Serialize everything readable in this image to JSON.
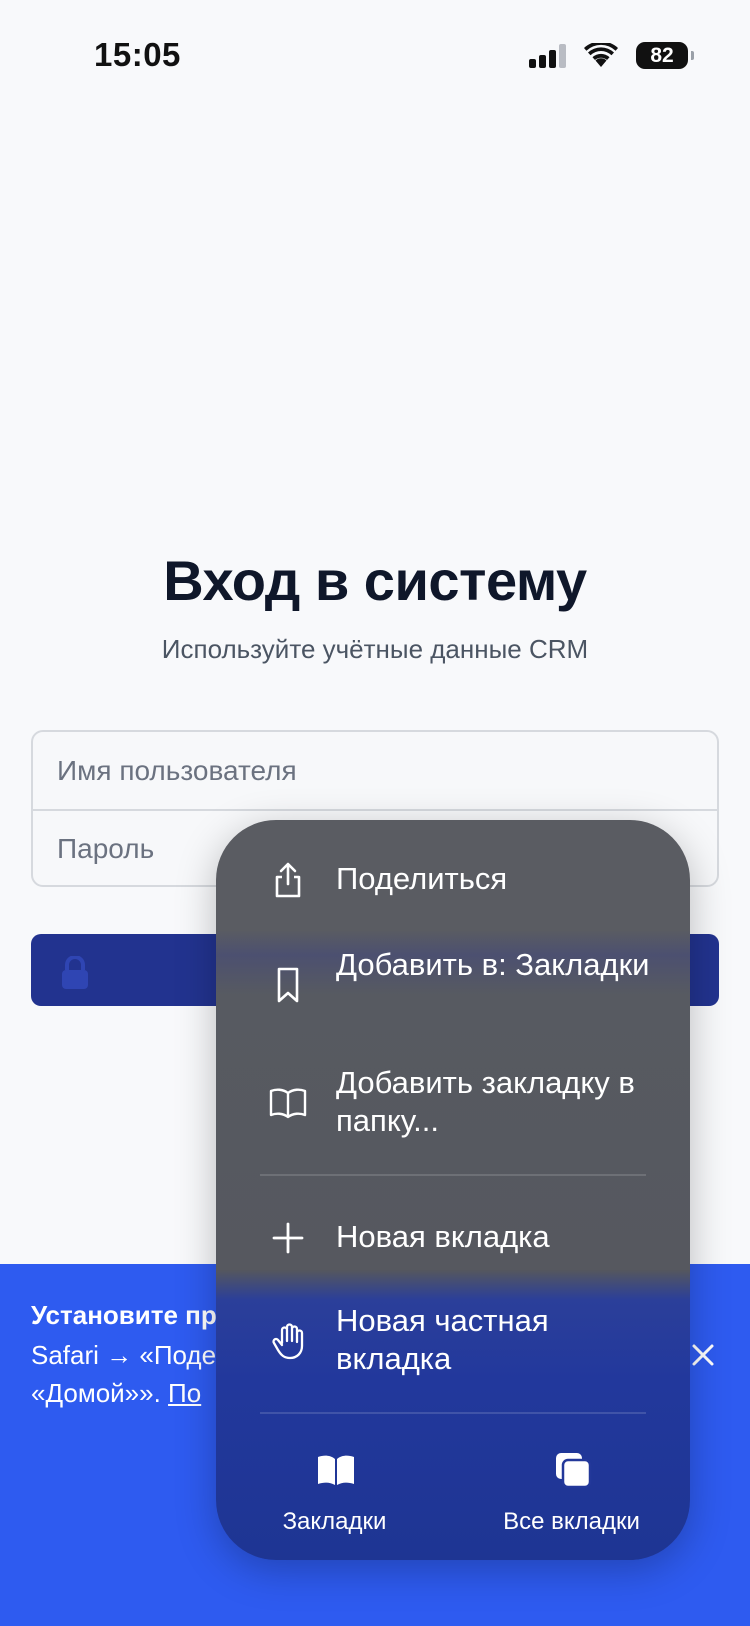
{
  "status_bar": {
    "time": "15:05",
    "battery": "82",
    "icons": [
      "signal-icon",
      "wifi-icon",
      "battery-icon"
    ]
  },
  "login": {
    "title": "Вход в систему",
    "subtitle": "Используйте учётные данные CRM",
    "username_placeholder": "Имя пользователя",
    "password_placeholder": "Пароль",
    "submit_icon": "lock-icon"
  },
  "banner": {
    "title": "Установите пр",
    "line1": "Safari → «Поде",
    "line2_text": "«Домой»». ",
    "line2_link": "По",
    "close_icon": "close-icon"
  },
  "context_menu": {
    "items": [
      {
        "label": "Поделиться",
        "icon": "share-icon"
      },
      {
        "label": "Добавить в: Закладки",
        "icon": "bookmark-icon"
      },
      {
        "label": "Добавить закладку в папку...",
        "icon": "open-book-icon"
      },
      {
        "label": "Новая вкладка",
        "icon": "plus-icon"
      },
      {
        "label": "Новая частная вкладка",
        "icon": "hand-icon"
      }
    ],
    "bottom": [
      {
        "label": "Закладки",
        "icon": "bookmarks-icon"
      },
      {
        "label": "Все вкладки",
        "icon": "tabs-icon"
      }
    ]
  },
  "colors": {
    "primary_button": "#22338f",
    "banner": "#2e5bf0",
    "menu_bg": "#5a5c62"
  }
}
